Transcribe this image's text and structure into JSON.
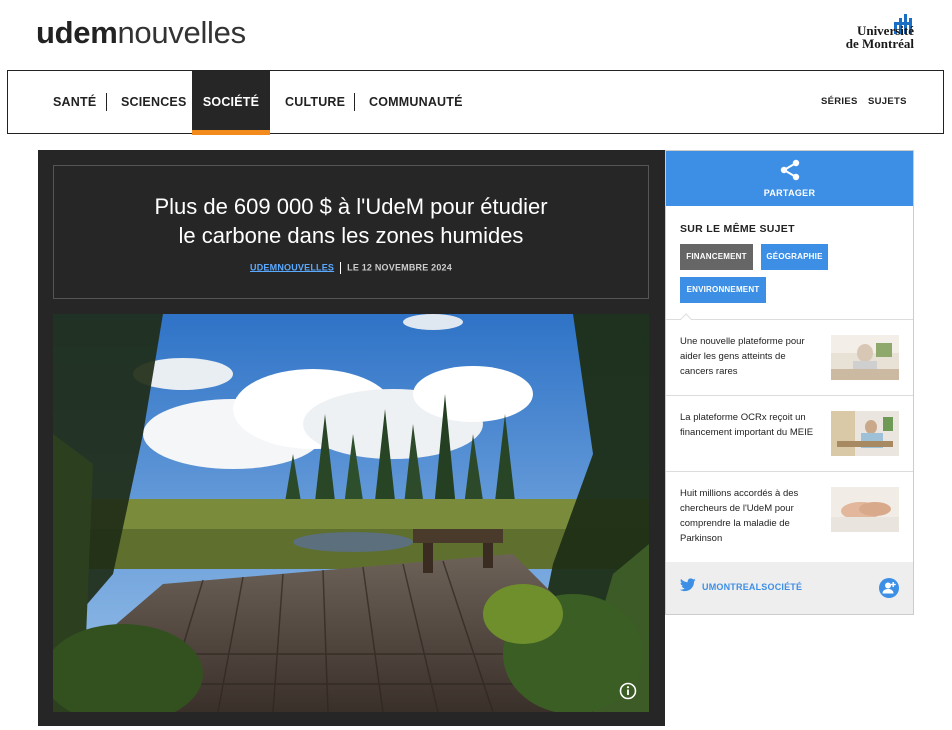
{
  "header": {
    "logo_bold": "udem",
    "logo_light": "nouvelles",
    "university_line1": "Université",
    "university_line2": "de Montréal"
  },
  "nav": {
    "items": [
      "SANTÉ",
      "SCIENCES",
      "SOCIÉTÉ",
      "CULTURE",
      "COMMUNAUTÉ"
    ],
    "active": "SOCIÉTÉ",
    "right_items": [
      "SÉRIES",
      "SUJETS"
    ],
    "accent_color": "#f28a1c"
  },
  "article": {
    "title_line1": "Plus de 609 000 $ à l'UdeM pour étudier",
    "title_line2": "le carbone dans les zones humides",
    "source": "UDEMNOUVELLES",
    "date": "LE 12 NOVEMBRE 2024",
    "photo_icon": "info-icon"
  },
  "sidebar": {
    "share_label": "PARTAGER",
    "share_icon": "share-icon",
    "same_subject_heading": "SUR LE MÊME SUJET",
    "tags": [
      "FINANCEMENT",
      "GÉOGRAPHIE",
      "ENVIRONNEMENT"
    ],
    "related": [
      {
        "text": "Une nouvelle plateforme pour aider les gens atteints de cancers rares"
      },
      {
        "text": "La plateforme OCRx reçoit un financement important du MEIE"
      },
      {
        "text": "Huit millions accordés à des chercheurs de l'UdeM pour comprendre la maladie de Parkinson"
      }
    ],
    "twitter_label": "UMONTREALSOCIÉTÉ",
    "brand_color": "#3d8fe6"
  }
}
